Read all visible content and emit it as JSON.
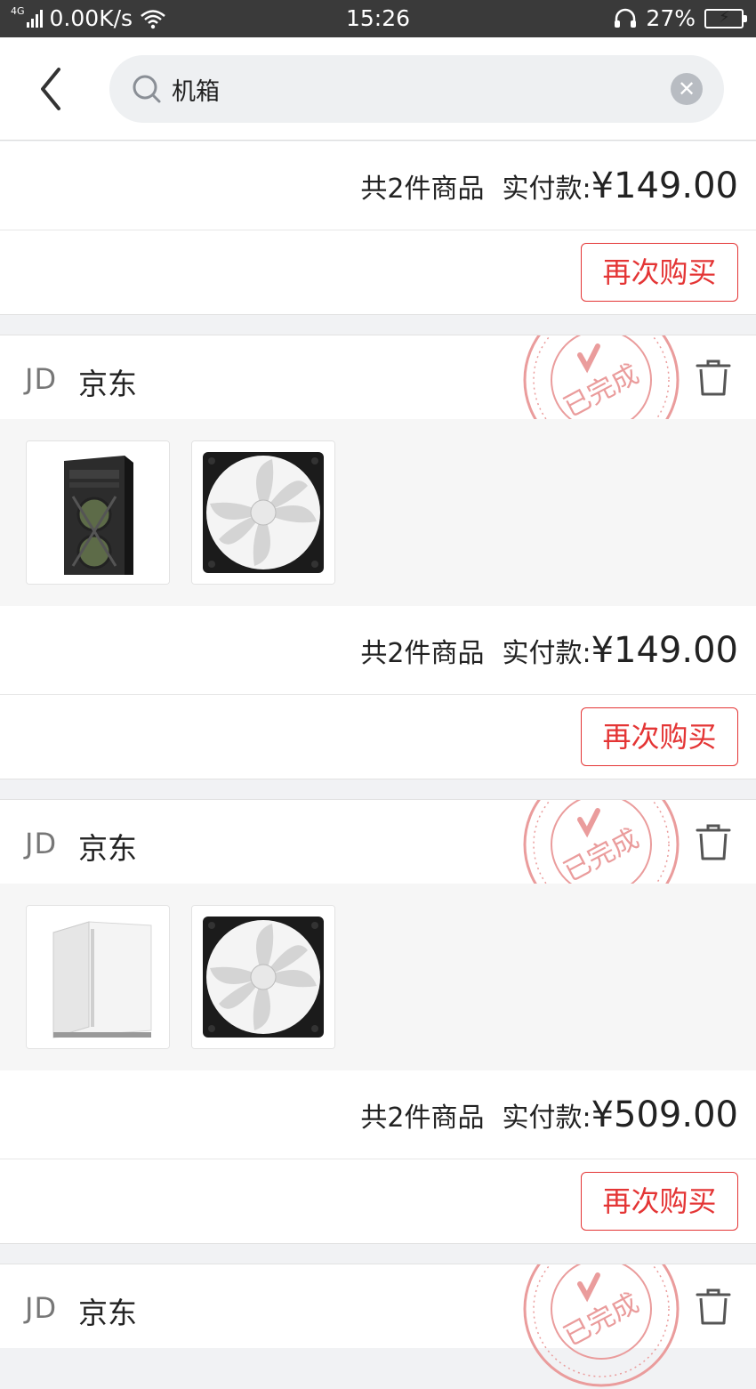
{
  "status_bar": {
    "network_type": "4G",
    "speed": "0.00K/s",
    "time": "15:26",
    "battery": "27%",
    "battery_level": 0.27
  },
  "search": {
    "query": "机箱"
  },
  "first_partial_order": {
    "count_text": "共2件商品",
    "pay_label": "实付款:",
    "amount": "¥149.00",
    "rebuy_label": "再次购买"
  },
  "orders": [
    {
      "shop_logo": "JD",
      "shop_name": "京东",
      "status_stamp": "已完成",
      "items": [
        "pc-case-black",
        "case-fan-white"
      ],
      "count_text": "共2件商品",
      "pay_label": "实付款:",
      "amount": "¥149.00",
      "rebuy_label": "再次购买"
    },
    {
      "shop_logo": "JD",
      "shop_name": "京东",
      "status_stamp": "已完成",
      "items": [
        "pc-case-white",
        "case-fan-white"
      ],
      "count_text": "共2件商品",
      "pay_label": "实付款:",
      "amount": "¥509.00",
      "rebuy_label": "再次购买"
    },
    {
      "shop_logo": "JD",
      "shop_name": "京东",
      "status_stamp": "已完成"
    }
  ],
  "colors": {
    "accent_red": "#e43535",
    "stamp_red": "#e88a8a"
  }
}
